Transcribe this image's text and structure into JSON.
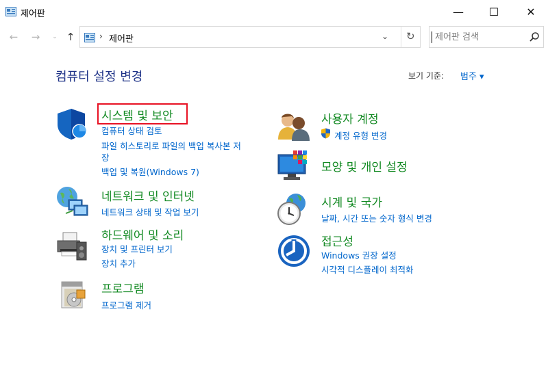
{
  "window": {
    "title": "제어판",
    "minimize_glyph": "—",
    "maximize_glyph": "☐",
    "close_glyph": "✕"
  },
  "nav": {
    "back_glyph": "←",
    "forward_glyph": "→",
    "recent_glyph": "⌄",
    "up_glyph": "↑",
    "breadcrumb_separator": "›",
    "breadcrumb": "제어판",
    "dropdown_glyph": "⌄",
    "refresh_glyph": "↻",
    "search_placeholder": "제어판 검색"
  },
  "header": {
    "title": "컴퓨터 설정 변경",
    "view_by_label": "보기 기준:",
    "view_by_value": "범주 ▾"
  },
  "categories": {
    "system_security": {
      "title": "시스템 및 보안",
      "links": [
        "컴퓨터 상태 검토",
        "파일 히스토리로 파일의 백업 복사본 저",
        "장",
        "백업 및 복원(Windows 7)"
      ]
    },
    "network": {
      "title": "네트워크 및 인터넷",
      "links": [
        "네트워크 상태 및 작업 보기"
      ]
    },
    "hardware": {
      "title": "하드웨어 및 소리",
      "links": [
        "장치 및 프린터 보기",
        "장치 추가"
      ]
    },
    "programs": {
      "title": "프로그램",
      "links": [
        "프로그램 제거"
      ]
    },
    "user_accounts": {
      "title": "사용자 계정",
      "links": [
        "계정 유형 변경"
      ]
    },
    "appearance": {
      "title": "모양 및 개인 설정",
      "links": []
    },
    "clock": {
      "title": "시계 및 국가",
      "links": [
        "날짜, 시간 또는 숫자 형식 변경"
      ]
    },
    "ease": {
      "title": "접근성",
      "links": [
        "Windows 권장 설정",
        "시각적 디스플레이 최적화"
      ]
    }
  },
  "colors": {
    "title_blue": "#1e3287",
    "category_green": "#138a23",
    "link_blue": "#0066cc",
    "highlight_red": "#e81123"
  }
}
